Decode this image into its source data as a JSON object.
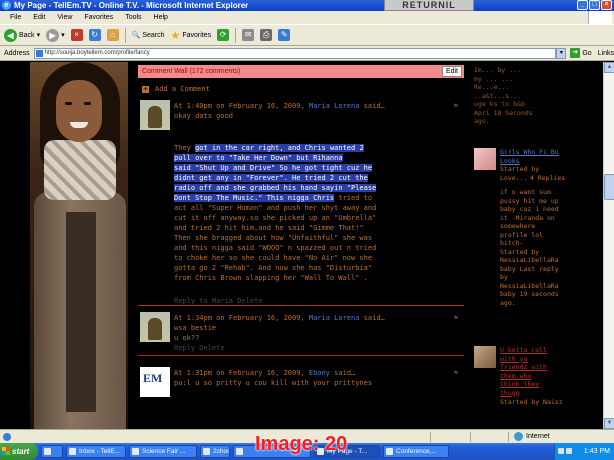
{
  "window": {
    "title": "My Page - TellEm.TV - Online T.V. - Microsoft Internet Explorer",
    "ad_button": "RETURNIL"
  },
  "menu": [
    "File",
    "Edit",
    "View",
    "Favorites",
    "Tools",
    "Help"
  ],
  "toolbar": {
    "back": "Back",
    "search": "Search",
    "favorites": "Favorites"
  },
  "address": {
    "label": "Address",
    "url": "http://soulja.boytellem.com/profile/fancy",
    "go": "Go",
    "links": "Links"
  },
  "wall": {
    "header": "Comment Wall (172 comments)",
    "edit": "Edit",
    "add_comment": "Add a Comment",
    "comments": [
      {
        "meta_prefix": "At 1:40pm on February 16, 2009,",
        "author": "Maria Lorena",
        "meta_suffix": "said…",
        "body": "okay dats good"
      },
      {
        "meta_prefix": "At 1:34pm on February 16, 2009,",
        "author": "Maria Lorena",
        "meta_suffix": "said…",
        "body": "wsa bestie\nu ok??",
        "actions": "Reply  Delete"
      },
      {
        "meta_prefix": "At 1:31pm on February 16, 2009,",
        "author": "Ebony",
        "meta_suffix": "said…",
        "body": "pu:l u so pritty u cou kill with your prittynes"
      }
    ],
    "story_lines": [
      [
        "They ",
        "got in the car right, and Chris wanted 2"
      ],
      [
        "",
        "pull over to \"Take Her Down\" but Rihanna"
      ],
      [
        "",
        "said \"Shut Up and Drive\" So he got tight cuz he"
      ],
      [
        "",
        "didnt get any in \"Forever\". He tried 2 cut the"
      ],
      [
        "",
        "radio off and she grabbed his hand sayin \"Please"
      ],
      [
        "",
        "Dont Stop The Music.\" This nigga Chris"
      ],
      [
        "act all \"Super Human\" and push her shyt away and",
        ""
      ],
      [
        "cut it off anyway.so she picked up an \"Umbrella\"",
        ""
      ],
      [
        "and tried 2 hit him,and he said \"Gimme That!\"",
        ""
      ],
      [
        "Then she bragged about how \"Unfaithful\" she was",
        ""
      ],
      [
        "and this nigga said \"WOOO\" n spazzed out n tried",
        ""
      ],
      [
        "to choke her so she could have \"No Air\" now she",
        ""
      ],
      [
        "gotta go 2 \"Rehab\". And now she has \"Disturbia\"",
        ""
      ],
      [
        "from Chris Brown slapping her \"Wall To Wall\" .",
        ""
      ]
    ],
    "story_tail": " tried to",
    "story_actions": "Reply to Maria   Delete"
  },
  "right_col": {
    "block1": "Im... by ...\nmy ... ...\nRe...e...\n..a&t...s...\nuge ks to b&b\nApri 18 Seconds\nago.",
    "block2_title": "Girls Who Fi Bu\nLooks",
    "block2_meta": "Started by\nLove...",
    "replies_label": "4 Replies",
    "block3": "if u want sum\npussy hit me up\nbaby cuz i need\nit -Miranda on\nsomewhere\nprofile lol\nbitch-\nStarted by\nNessiaLibellaRa\nbaby Last reply\nby\nNessiaLibellaRa\nbaby 19 seconds\nago.",
    "block4_title": "U betta roll\nwith ya\nfriendz with\nthem who\nthink they\nthugg",
    "block4_meta": "Started by Naisz"
  },
  "status": {
    "text": "",
    "zone": "Internet"
  },
  "taskbar": {
    "start": "start",
    "tasks": [
      "Inbox - TellE...",
      "Science Fair ...",
      "2choc...",
      "",
      "My Page - T...",
      "Conference,..."
    ],
    "clock": "1:43 PM"
  },
  "watermark": "Image: 20"
}
